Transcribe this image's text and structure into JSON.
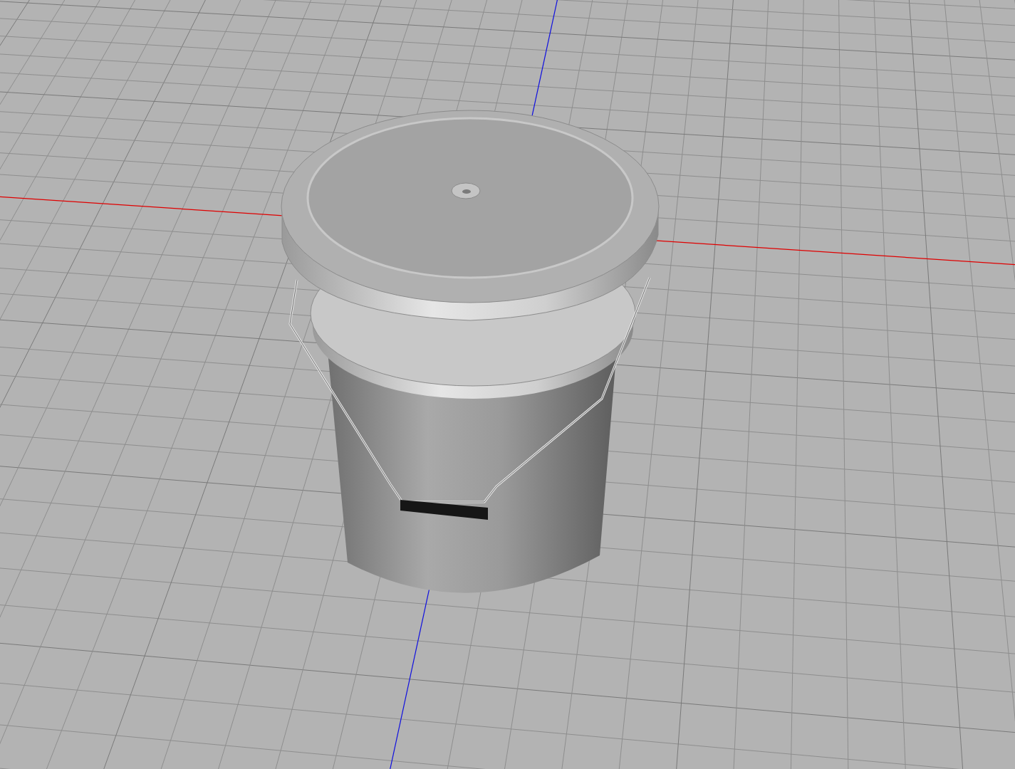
{
  "viewport": {
    "kind": "grid"
  }
}
